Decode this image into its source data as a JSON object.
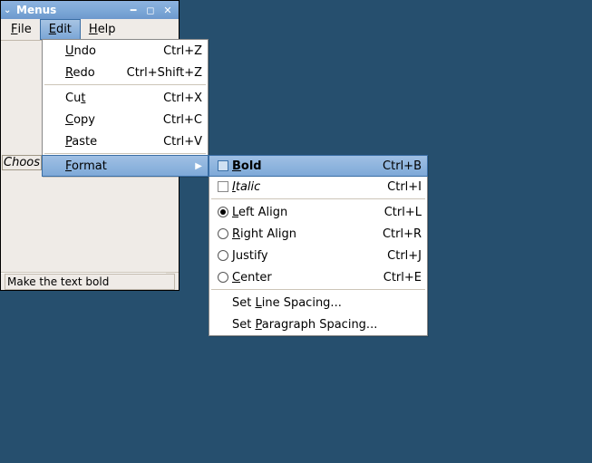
{
  "window": {
    "title": "Menus"
  },
  "menubar": {
    "file": "File",
    "edit": "Edit",
    "help": "Help"
  },
  "label_choose": "Choos",
  "statusbar": "Make the text bold",
  "edit_menu": {
    "undo": {
      "label": "Undo",
      "shortcut": "Ctrl+Z"
    },
    "redo": {
      "label": "Redo",
      "shortcut": "Ctrl+Shift+Z"
    },
    "cut": {
      "label": "Cut",
      "shortcut": "Ctrl+X"
    },
    "copy": {
      "label": "Copy",
      "shortcut": "Ctrl+C"
    },
    "paste": {
      "label": "Paste",
      "shortcut": "Ctrl+V"
    },
    "format": {
      "label": "Format"
    }
  },
  "format_menu": {
    "bold": {
      "label": "Bold",
      "shortcut": "Ctrl+B"
    },
    "italic": {
      "label": "Italic",
      "shortcut": "Ctrl+I"
    },
    "left": {
      "label": "Left Align",
      "shortcut": "Ctrl+L"
    },
    "right": {
      "label": "Right Align",
      "shortcut": "Ctrl+R"
    },
    "justify": {
      "label": "Justify",
      "shortcut": "Ctrl+J"
    },
    "center": {
      "label": "Center",
      "shortcut": "Ctrl+E"
    },
    "line": {
      "label": "Set Line Spacing..."
    },
    "para": {
      "label": "Set Paragraph Spacing..."
    }
  },
  "underline_map": {
    "File": "F",
    "Edit": "E",
    "Help": "H",
    "Undo": "U",
    "Redo": "R",
    "Cut": "t",
    "Copy": "C",
    "Paste": "P",
    "Format": "F",
    "Bold": "B",
    "Italic": "I",
    "Left Align": "L",
    "Right Align": "R",
    "Justify": "J",
    "Center": "C",
    "Set Line Spacing...": "L",
    "Set Paragraph Spacing...": "P"
  }
}
